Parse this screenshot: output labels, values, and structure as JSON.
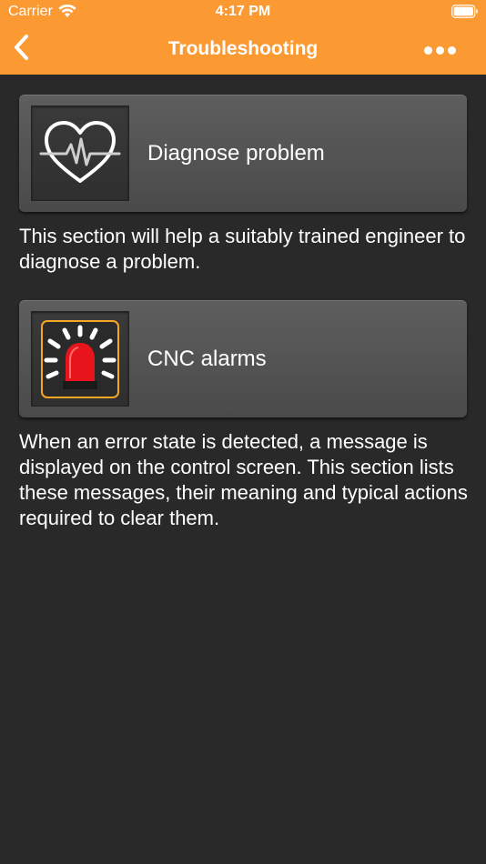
{
  "status_bar": {
    "carrier": "Carrier",
    "time": "4:17 PM",
    "wifi_icon": "wifi-icon",
    "battery_icon": "battery-icon"
  },
  "nav": {
    "title": "Troubleshooting",
    "back_icon": "chevron-left-icon",
    "more_icon": "ellipsis-icon",
    "bar_color": "#fb9a33"
  },
  "items": [
    {
      "label": "Diagnose problem",
      "icon": "heartbeat-icon",
      "description": "This section will help a suitably trained engineer to diagnose a problem."
    },
    {
      "label": "CNC alarms",
      "icon": "alarm-beacon-icon",
      "description": "When an error state is detected, a message is displayed on the control screen. This section lists these messages, their meaning and typical actions required to clear them."
    }
  ],
  "colors": {
    "background": "#292929",
    "alarm_red": "#e8141c",
    "alarm_border": "#f5a623"
  }
}
